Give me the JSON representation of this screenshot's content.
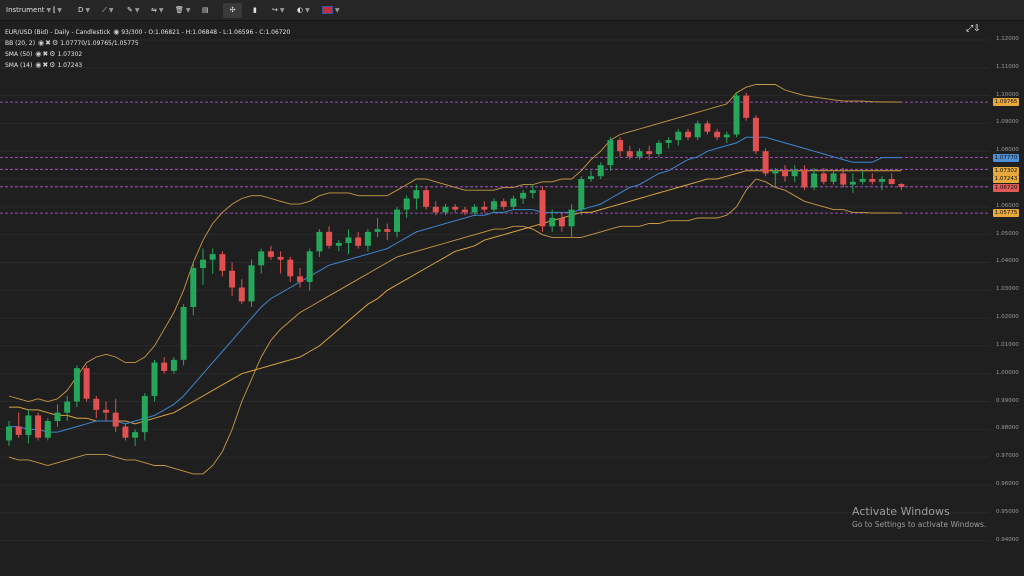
{
  "toolbar": {
    "instrument": "Instrument",
    "timeframe": "D",
    "icons": [
      "candles-icon",
      "line-tool-icon",
      "pencil-icon",
      "indicators-icon",
      "trash-icon",
      "layout-icon",
      "crosshair-icon",
      "chart-type-icon",
      "share-icon",
      "theme-icon",
      "flag-uk-icon"
    ]
  },
  "legend": {
    "main": "EUR/USD (Bid) - Daily - Candlestick",
    "main_count": "93/300",
    "ohlc": "O:1.06821 - H:1.06848 - L:1.06596 - C:1.06720",
    "bb_label": "BB (20, 2)",
    "bb_values": "1.07770/1.09765/1.05775",
    "sma50_label": "SMA (50)",
    "sma50_value": "1.07302",
    "sma14_label": "SMA (14)",
    "sma14_value": "1.07243"
  },
  "price_tags": [
    {
      "value": "1.09765",
      "color": "#e8a93c"
    },
    {
      "value": "1.07770",
      "color": "#4d8fd6"
    },
    {
      "value": "1.07302",
      "color": "#e8a93c"
    },
    {
      "value": "1.07243",
      "color": "#e8a93c"
    },
    {
      "value": "1.06720",
      "color": "#e05a5a"
    },
    {
      "value": "1.05775",
      "color": "#e8a93c"
    }
  ],
  "watermark": {
    "title": "Activate Windows",
    "subtitle": "Go to Settings to activate Windows."
  },
  "colors": {
    "bull": "#26a65b",
    "bear": "#e05050",
    "sma50": "#d9a441",
    "sma14": "#3f86d1",
    "bb": "#c89a45",
    "hline": "#b45bd6"
  },
  "chart_data": {
    "type": "candlestick",
    "instrument": "EUR/USD",
    "timeframe": "Daily",
    "y_ticks": [
      "1.12000",
      "1.11000",
      "1.10000",
      "1.09000",
      "1.08000",
      "1.07000",
      "1.06000",
      "1.05000",
      "1.04000",
      "1.03000",
      "1.02000",
      "1.01000",
      "1.00000",
      "0.99000",
      "0.98000",
      "0.97000",
      "0.96000",
      "0.95000",
      "0.94000"
    ],
    "ylim": [
      0.9395,
      1.1225
    ],
    "horizontal_levels": [
      1.09765,
      1.0777,
      1.0735,
      1.0672,
      1.05775
    ],
    "candles": [
      [
        0.976,
        0.983,
        0.974,
        0.981
      ],
      [
        0.981,
        0.986,
        0.977,
        0.978
      ],
      [
        0.978,
        0.987,
        0.975,
        0.985
      ],
      [
        0.985,
        0.986,
        0.976,
        0.977
      ],
      [
        0.977,
        0.984,
        0.976,
        0.983
      ],
      [
        0.983,
        0.989,
        0.981,
        0.986
      ],
      [
        0.986,
        0.992,
        0.983,
        0.99
      ],
      [
        0.99,
        1.003,
        0.988,
        1.002
      ],
      [
        1.002,
        1.003,
        0.99,
        0.991
      ],
      [
        0.991,
        0.992,
        0.984,
        0.987
      ],
      [
        0.987,
        0.99,
        0.983,
        0.986
      ],
      [
        0.986,
        0.991,
        0.979,
        0.981
      ],
      [
        0.981,
        0.982,
        0.976,
        0.977
      ],
      [
        0.977,
        0.98,
        0.974,
        0.979
      ],
      [
        0.979,
        0.993,
        0.976,
        0.992
      ],
      [
        0.992,
        1.005,
        0.99,
        1.004
      ],
      [
        1.004,
        1.006,
        1.0,
        1.001
      ],
      [
        1.001,
        1.006,
        1.0,
        1.005
      ],
      [
        1.005,
        1.025,
        1.003,
        1.024
      ],
      [
        1.024,
        1.04,
        1.021,
        1.038
      ],
      [
        1.038,
        1.045,
        1.032,
        1.041
      ],
      [
        1.041,
        1.045,
        1.036,
        1.043
      ],
      [
        1.043,
        1.044,
        1.035,
        1.037
      ],
      [
        1.037,
        1.04,
        1.028,
        1.031
      ],
      [
        1.031,
        1.034,
        1.025,
        1.026
      ],
      [
        1.026,
        1.041,
        1.024,
        1.039
      ],
      [
        1.039,
        1.045,
        1.036,
        1.044
      ],
      [
        1.044,
        1.046,
        1.041,
        1.042
      ],
      [
        1.042,
        1.044,
        1.036,
        1.041
      ],
      [
        1.041,
        1.042,
        1.033,
        1.035
      ],
      [
        1.035,
        1.038,
        1.031,
        1.033
      ],
      [
        1.033,
        1.045,
        1.03,
        1.044
      ],
      [
        1.044,
        1.052,
        1.042,
        1.051
      ],
      [
        1.051,
        1.053,
        1.045,
        1.046
      ],
      [
        1.046,
        1.048,
        1.044,
        1.047
      ],
      [
        1.047,
        1.052,
        1.043,
        1.049
      ],
      [
        1.049,
        1.051,
        1.045,
        1.046
      ],
      [
        1.046,
        1.052,
        1.044,
        1.051
      ],
      [
        1.051,
        1.056,
        1.049,
        1.052
      ],
      [
        1.052,
        1.054,
        1.048,
        1.051
      ],
      [
        1.051,
        1.06,
        1.049,
        1.059
      ],
      [
        1.059,
        1.064,
        1.056,
        1.063
      ],
      [
        1.063,
        1.068,
        1.059,
        1.066
      ],
      [
        1.066,
        1.067,
        1.059,
        1.06
      ],
      [
        1.06,
        1.062,
        1.057,
        1.058
      ],
      [
        1.058,
        1.061,
        1.057,
        1.06
      ],
      [
        1.06,
        1.061,
        1.058,
        1.059
      ],
      [
        1.059,
        1.06,
        1.057,
        1.058
      ],
      [
        1.058,
        1.061,
        1.057,
        1.06
      ],
      [
        1.06,
        1.062,
        1.058,
        1.059
      ],
      [
        1.059,
        1.063,
        1.058,
        1.062
      ],
      [
        1.062,
        1.063,
        1.059,
        1.06
      ],
      [
        1.06,
        1.064,
        1.059,
        1.063
      ],
      [
        1.063,
        1.066,
        1.061,
        1.065
      ],
      [
        1.065,
        1.068,
        1.063,
        1.066
      ],
      [
        1.066,
        1.067,
        1.051,
        1.053
      ],
      [
        1.053,
        1.059,
        1.051,
        1.056
      ],
      [
        1.056,
        1.058,
        1.051,
        1.053
      ],
      [
        1.053,
        1.061,
        1.049,
        1.059
      ],
      [
        1.059,
        1.071,
        1.057,
        1.07
      ],
      [
        1.07,
        1.073,
        1.069,
        1.071
      ],
      [
        1.071,
        1.076,
        1.07,
        1.075
      ],
      [
        1.075,
        1.085,
        1.073,
        1.084
      ],
      [
        1.084,
        1.085,
        1.078,
        1.08
      ],
      [
        1.08,
        1.082,
        1.077,
        1.078
      ],
      [
        1.078,
        1.081,
        1.077,
        1.08
      ],
      [
        1.08,
        1.082,
        1.077,
        1.079
      ],
      [
        1.079,
        1.084,
        1.078,
        1.083
      ],
      [
        1.083,
        1.085,
        1.081,
        1.084
      ],
      [
        1.084,
        1.088,
        1.082,
        1.087
      ],
      [
        1.087,
        1.088,
        1.084,
        1.085
      ],
      [
        1.085,
        1.091,
        1.084,
        1.09
      ],
      [
        1.09,
        1.091,
        1.086,
        1.087
      ],
      [
        1.087,
        1.088,
        1.084,
        1.085
      ],
      [
        1.085,
        1.087,
        1.083,
        1.086
      ],
      [
        1.086,
        1.101,
        1.085,
        1.1
      ],
      [
        1.1,
        1.101,
        1.091,
        1.092
      ],
      [
        1.092,
        1.093,
        1.079,
        1.08
      ],
      [
        1.08,
        1.081,
        1.071,
        1.072
      ],
      [
        1.072,
        1.074,
        1.067,
        1.073
      ],
      [
        1.073,
        1.075,
        1.069,
        1.071
      ],
      [
        1.071,
        1.075,
        1.069,
        1.073
      ],
      [
        1.073,
        1.075,
        1.066,
        1.067
      ],
      [
        1.067,
        1.074,
        1.066,
        1.072
      ],
      [
        1.072,
        1.074,
        1.068,
        1.069
      ],
      [
        1.069,
        1.073,
        1.068,
        1.072
      ],
      [
        1.072,
        1.074,
        1.067,
        1.068
      ],
      [
        1.068,
        1.072,
        1.065,
        1.069
      ],
      [
        1.069,
        1.073,
        1.068,
        1.07
      ],
      [
        1.07,
        1.072,
        1.068,
        1.069
      ],
      [
        1.069,
        1.071,
        1.066,
        1.07
      ],
      [
        1.07,
        1.072,
        1.068,
        1.0682
      ],
      [
        1.06821,
        1.06848,
        1.06596,
        1.0672
      ]
    ],
    "sma50": [
      0.988,
      0.988,
      0.987,
      0.987,
      0.986,
      0.985,
      0.985,
      0.984,
      0.984,
      0.983,
      0.983,
      0.983,
      0.983,
      0.982,
      0.983,
      0.984,
      0.985,
      0.986,
      0.988,
      0.99,
      0.992,
      0.994,
      0.996,
      0.998,
      1.0,
      1.001,
      1.002,
      1.003,
      1.004,
      1.005,
      1.006,
      1.008,
      1.01,
      1.013,
      1.016,
      1.019,
      1.022,
      1.025,
      1.027,
      1.03,
      1.032,
      1.034,
      1.036,
      1.038,
      1.04,
      1.042,
      1.044,
      1.045,
      1.046,
      1.048,
      1.049,
      1.05,
      1.051,
      1.052,
      1.053,
      1.054,
      1.055,
      1.056,
      1.057,
      1.058,
      1.058,
      1.059,
      1.06,
      1.061,
      1.062,
      1.063,
      1.064,
      1.065,
      1.066,
      1.067,
      1.068,
      1.069,
      1.07,
      1.07,
      1.071,
      1.072,
      1.073,
      1.073,
      1.073,
      1.073,
      1.073,
      1.073,
      1.073,
      1.073,
      1.073,
      1.073,
      1.073,
      1.073,
      1.073,
      1.073,
      1.073,
      1.073,
      1.073
    ],
    "sma14": [
      0.981,
      0.981,
      0.98,
      0.98,
      0.979,
      0.979,
      0.98,
      0.981,
      0.982,
      0.983,
      0.983,
      0.983,
      0.982,
      0.983,
      0.984,
      0.985,
      0.987,
      0.989,
      0.992,
      0.996,
      1.0,
      1.004,
      1.008,
      1.012,
      1.016,
      1.02,
      1.024,
      1.027,
      1.029,
      1.031,
      1.033,
      1.035,
      1.037,
      1.039,
      1.04,
      1.041,
      1.042,
      1.043,
      1.044,
      1.045,
      1.047,
      1.049,
      1.051,
      1.052,
      1.053,
      1.054,
      1.055,
      1.056,
      1.057,
      1.057,
      1.058,
      1.058,
      1.059,
      1.059,
      1.059,
      1.058,
      1.058,
      1.058,
      1.058,
      1.059,
      1.06,
      1.061,
      1.063,
      1.065,
      1.067,
      1.068,
      1.07,
      1.072,
      1.073,
      1.075,
      1.077,
      1.078,
      1.08,
      1.081,
      1.082,
      1.083,
      1.085,
      1.085,
      1.085,
      1.084,
      1.083,
      1.082,
      1.081,
      1.08,
      1.079,
      1.078,
      1.077,
      1.076,
      1.076,
      1.076,
      1.0777,
      1.0777,
      1.0777
    ],
    "bb_upper": [
      0.992,
      0.991,
      0.99,
      0.991,
      0.99,
      0.991,
      0.994,
      0.999,
      1.004,
      1.006,
      1.007,
      1.006,
      1.004,
      1.004,
      1.006,
      1.01,
      1.016,
      1.022,
      1.03,
      1.04,
      1.048,
      1.054,
      1.058,
      1.061,
      1.063,
      1.064,
      1.064,
      1.063,
      1.062,
      1.061,
      1.061,
      1.062,
      1.064,
      1.065,
      1.065,
      1.065,
      1.064,
      1.064,
      1.064,
      1.064,
      1.066,
      1.068,
      1.07,
      1.07,
      1.069,
      1.068,
      1.067,
      1.066,
      1.066,
      1.066,
      1.066,
      1.067,
      1.067,
      1.068,
      1.068,
      1.069,
      1.069,
      1.07,
      1.07,
      1.073,
      1.077,
      1.08,
      1.084,
      1.086,
      1.087,
      1.088,
      1.089,
      1.09,
      1.091,
      1.092,
      1.093,
      1.094,
      1.095,
      1.096,
      1.097,
      1.101,
      1.103,
      1.104,
      1.104,
      1.104,
      1.102,
      1.101,
      1.1,
      1.0995,
      1.099,
      1.0985,
      1.098,
      1.098,
      1.098,
      1.0978,
      1.0977,
      1.0977,
      1.09765
    ],
    "bb_lower": [
      0.97,
      0.969,
      0.969,
      0.968,
      0.967,
      0.968,
      0.969,
      0.97,
      0.971,
      0.971,
      0.971,
      0.97,
      0.969,
      0.969,
      0.968,
      0.967,
      0.967,
      0.966,
      0.965,
      0.964,
      0.964,
      0.967,
      0.972,
      0.98,
      0.99,
      0.998,
      1.006,
      1.012,
      1.016,
      1.019,
      1.022,
      1.024,
      1.026,
      1.028,
      1.03,
      1.032,
      1.034,
      1.036,
      1.038,
      1.04,
      1.042,
      1.043,
      1.044,
      1.045,
      1.046,
      1.047,
      1.048,
      1.049,
      1.05,
      1.051,
      1.052,
      1.052,
      1.053,
      1.053,
      1.052,
      1.05,
      1.049,
      1.049,
      1.049,
      1.049,
      1.05,
      1.051,
      1.052,
      1.053,
      1.053,
      1.053,
      1.054,
      1.054,
      1.055,
      1.055,
      1.055,
      1.056,
      1.056,
      1.056,
      1.057,
      1.06,
      1.066,
      1.07,
      1.069,
      1.067,
      1.066,
      1.064,
      1.062,
      1.061,
      1.06,
      1.059,
      1.059,
      1.058,
      1.058,
      1.0578,
      1.0578,
      1.0578,
      1.05775
    ],
    "last_price": 1.0672
  }
}
